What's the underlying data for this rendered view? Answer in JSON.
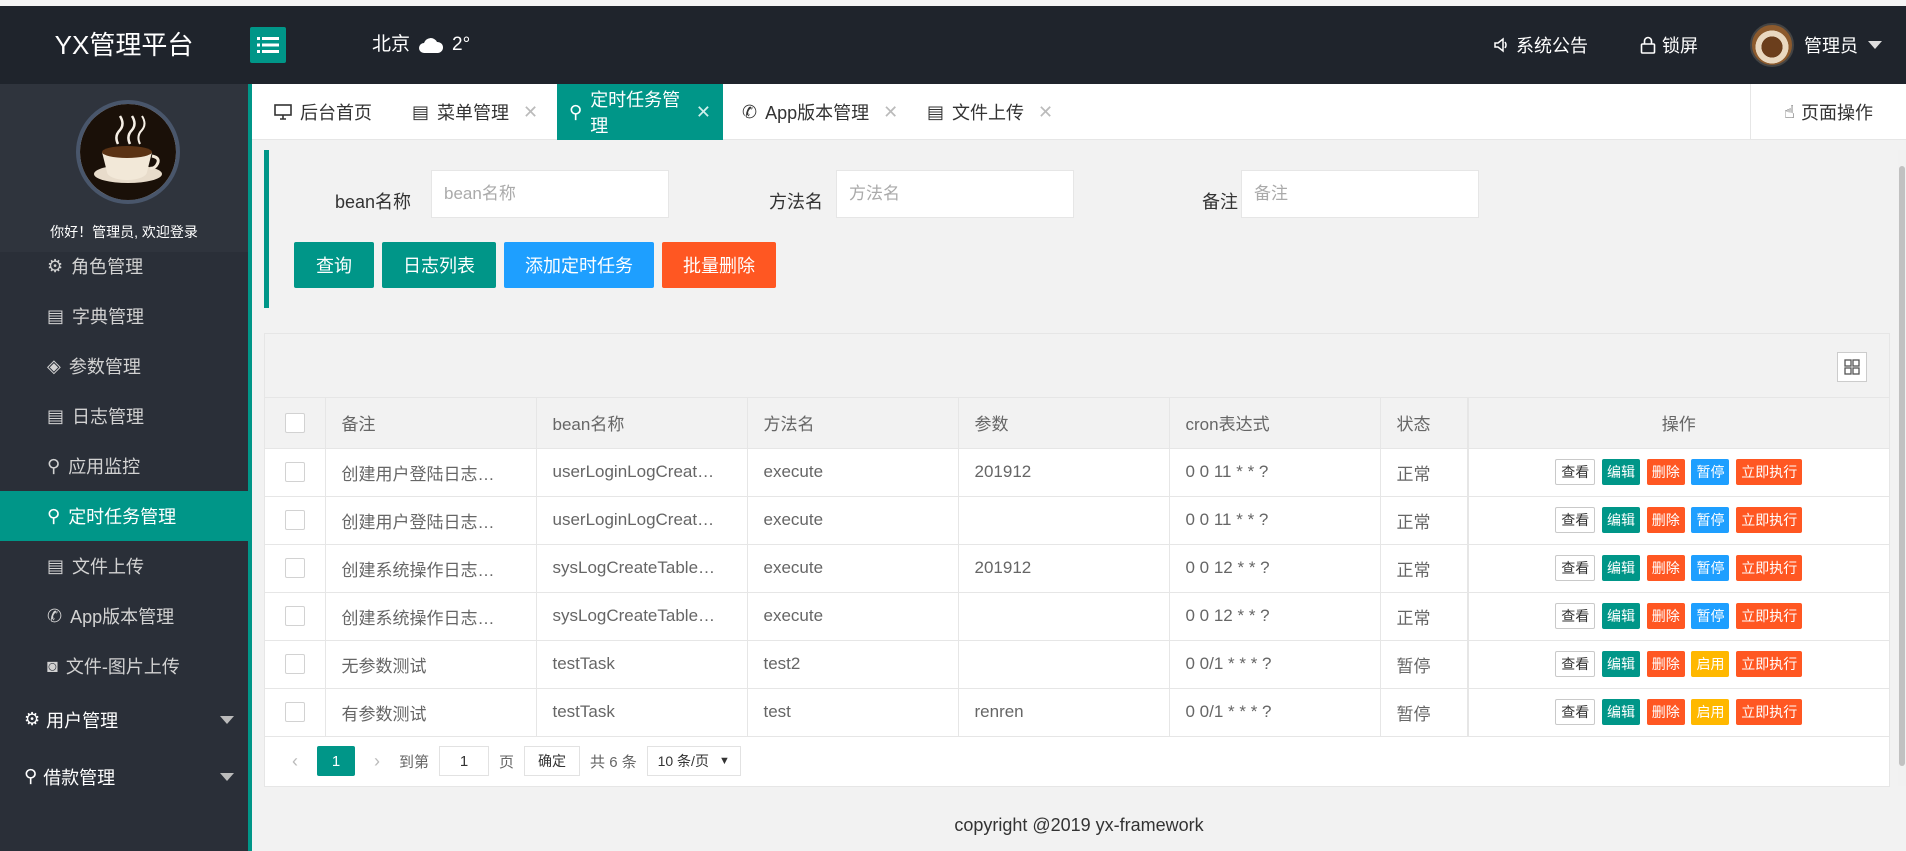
{
  "header": {
    "logo": "YX管理平台",
    "weather_city": "北京",
    "weather_temp": "2°",
    "announcement": "系统公告",
    "lock": "锁屏",
    "user": "管理员"
  },
  "sidebar": {
    "welcome": "你好！管理员, 欢迎登录",
    "items": [
      {
        "label": "角色管理",
        "icon": "role-icon"
      },
      {
        "label": "字典管理",
        "icon": "dictionary-icon"
      },
      {
        "label": "参数管理",
        "icon": "layers-icon"
      },
      {
        "label": "日志管理",
        "icon": "log-icon"
      },
      {
        "label": "应用监控",
        "icon": "monitor-icon"
      },
      {
        "label": "定时任务管理",
        "icon": "schedule-icon"
      },
      {
        "label": "文件上传",
        "icon": "file-icon"
      },
      {
        "label": "App版本管理",
        "icon": "app-icon"
      },
      {
        "label": "文件-图片上传",
        "icon": "image-icon"
      }
    ],
    "groups": [
      {
        "label": "用户管理",
        "icon": "gear-icon"
      },
      {
        "label": "借款管理",
        "icon": "user-icon"
      }
    ]
  },
  "tabs": [
    {
      "label": "后台首页"
    },
    {
      "label": "菜单管理"
    },
    {
      "label": "定时任务管理"
    },
    {
      "label": "App版本管理"
    },
    {
      "label": "文件上传"
    }
  ],
  "page_op": "页面操作",
  "search": {
    "bean_label": "bean名称",
    "bean_placeholder": "bean名称",
    "method_label": "方法名",
    "method_placeholder": "方法名",
    "remark_label": "备注",
    "remark_placeholder": "备注"
  },
  "buttons": {
    "query": "查询",
    "log_list": "日志列表",
    "add_task": "添加定时任务",
    "batch_delete": "批量删除"
  },
  "table": {
    "columns": [
      "备注",
      "bean名称",
      "方法名",
      "参数",
      "cron表达式",
      "状态",
      "操作"
    ],
    "rows": [
      [
        "创建用户登陆日志…",
        "userLoginLogCreat…",
        "execute",
        "201912",
        "0 0 11 * * ?",
        "正常",
        "暂停"
      ],
      [
        "创建用户登陆日志…",
        "userLoginLogCreat…",
        "execute",
        "",
        "0 0 11 * * ?",
        "正常",
        "暂停"
      ],
      [
        "创建系统操作日志…",
        "sysLogCreateTable…",
        "execute",
        "201912",
        "0 0 12 * * ?",
        "正常",
        "暂停"
      ],
      [
        "创建系统操作日志…",
        "sysLogCreateTable…",
        "execute",
        "",
        "0 0 12 * * ?",
        "正常",
        "暂停"
      ],
      [
        "无参数测试",
        "testTask",
        "test2",
        "",
        "0 0/1 * * * ?",
        "暂停",
        "启用"
      ],
      [
        "有参数测试",
        "testTask",
        "test",
        "renren",
        "0 0/1 * * * ?",
        "暂停",
        "启用"
      ]
    ],
    "op_view": "查看",
    "op_edit": "编辑",
    "op_delete": "删除",
    "op_run": "立即执行"
  },
  "pager": {
    "current": "1",
    "goto": "到第",
    "page_input": "1",
    "page_unit": "页",
    "confirm": "确定",
    "total": "共 6 条",
    "page_size": "10 条/页"
  },
  "footer": "copyright @2019 yx-framework",
  "colors": {
    "primary": "#009688",
    "danger": "#ff5722",
    "info": "#1e9fff",
    "warn": "#ffb800",
    "header_bg": "#1f242c",
    "sidebar_bg": "#2a2f38"
  }
}
